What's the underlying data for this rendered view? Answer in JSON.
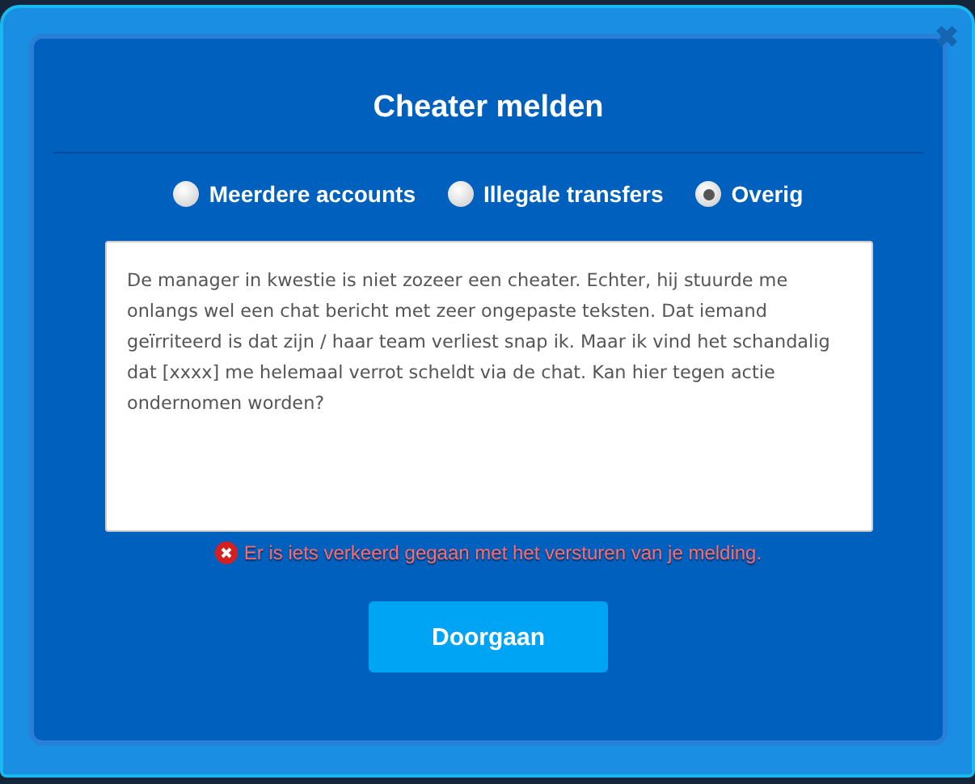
{
  "dialog": {
    "title": "Cheater melden",
    "close_label": "✖"
  },
  "reasons": [
    {
      "label": "Meerdere accounts",
      "selected": false
    },
    {
      "label": "Illegale transfers",
      "selected": false
    },
    {
      "label": "Overig",
      "selected": true
    }
  ],
  "message": {
    "value": "De manager in kwestie is niet zozeer een cheater. Echter, hij stuurde me onlangs wel een chat bericht met zeer ongepaste teksten. Dat iemand geïrriteerd is dat zijn / haar team verliest snap ik. Maar ik vind het schandalig dat [xxxx] me helemaal verrot scheldt via de chat. Kan hier tegen actie ondernomen worden?"
  },
  "error": {
    "text": "Er is iets verkeerd gegaan met het versturen van je melding."
  },
  "button": {
    "label": "Doorgaan"
  }
}
